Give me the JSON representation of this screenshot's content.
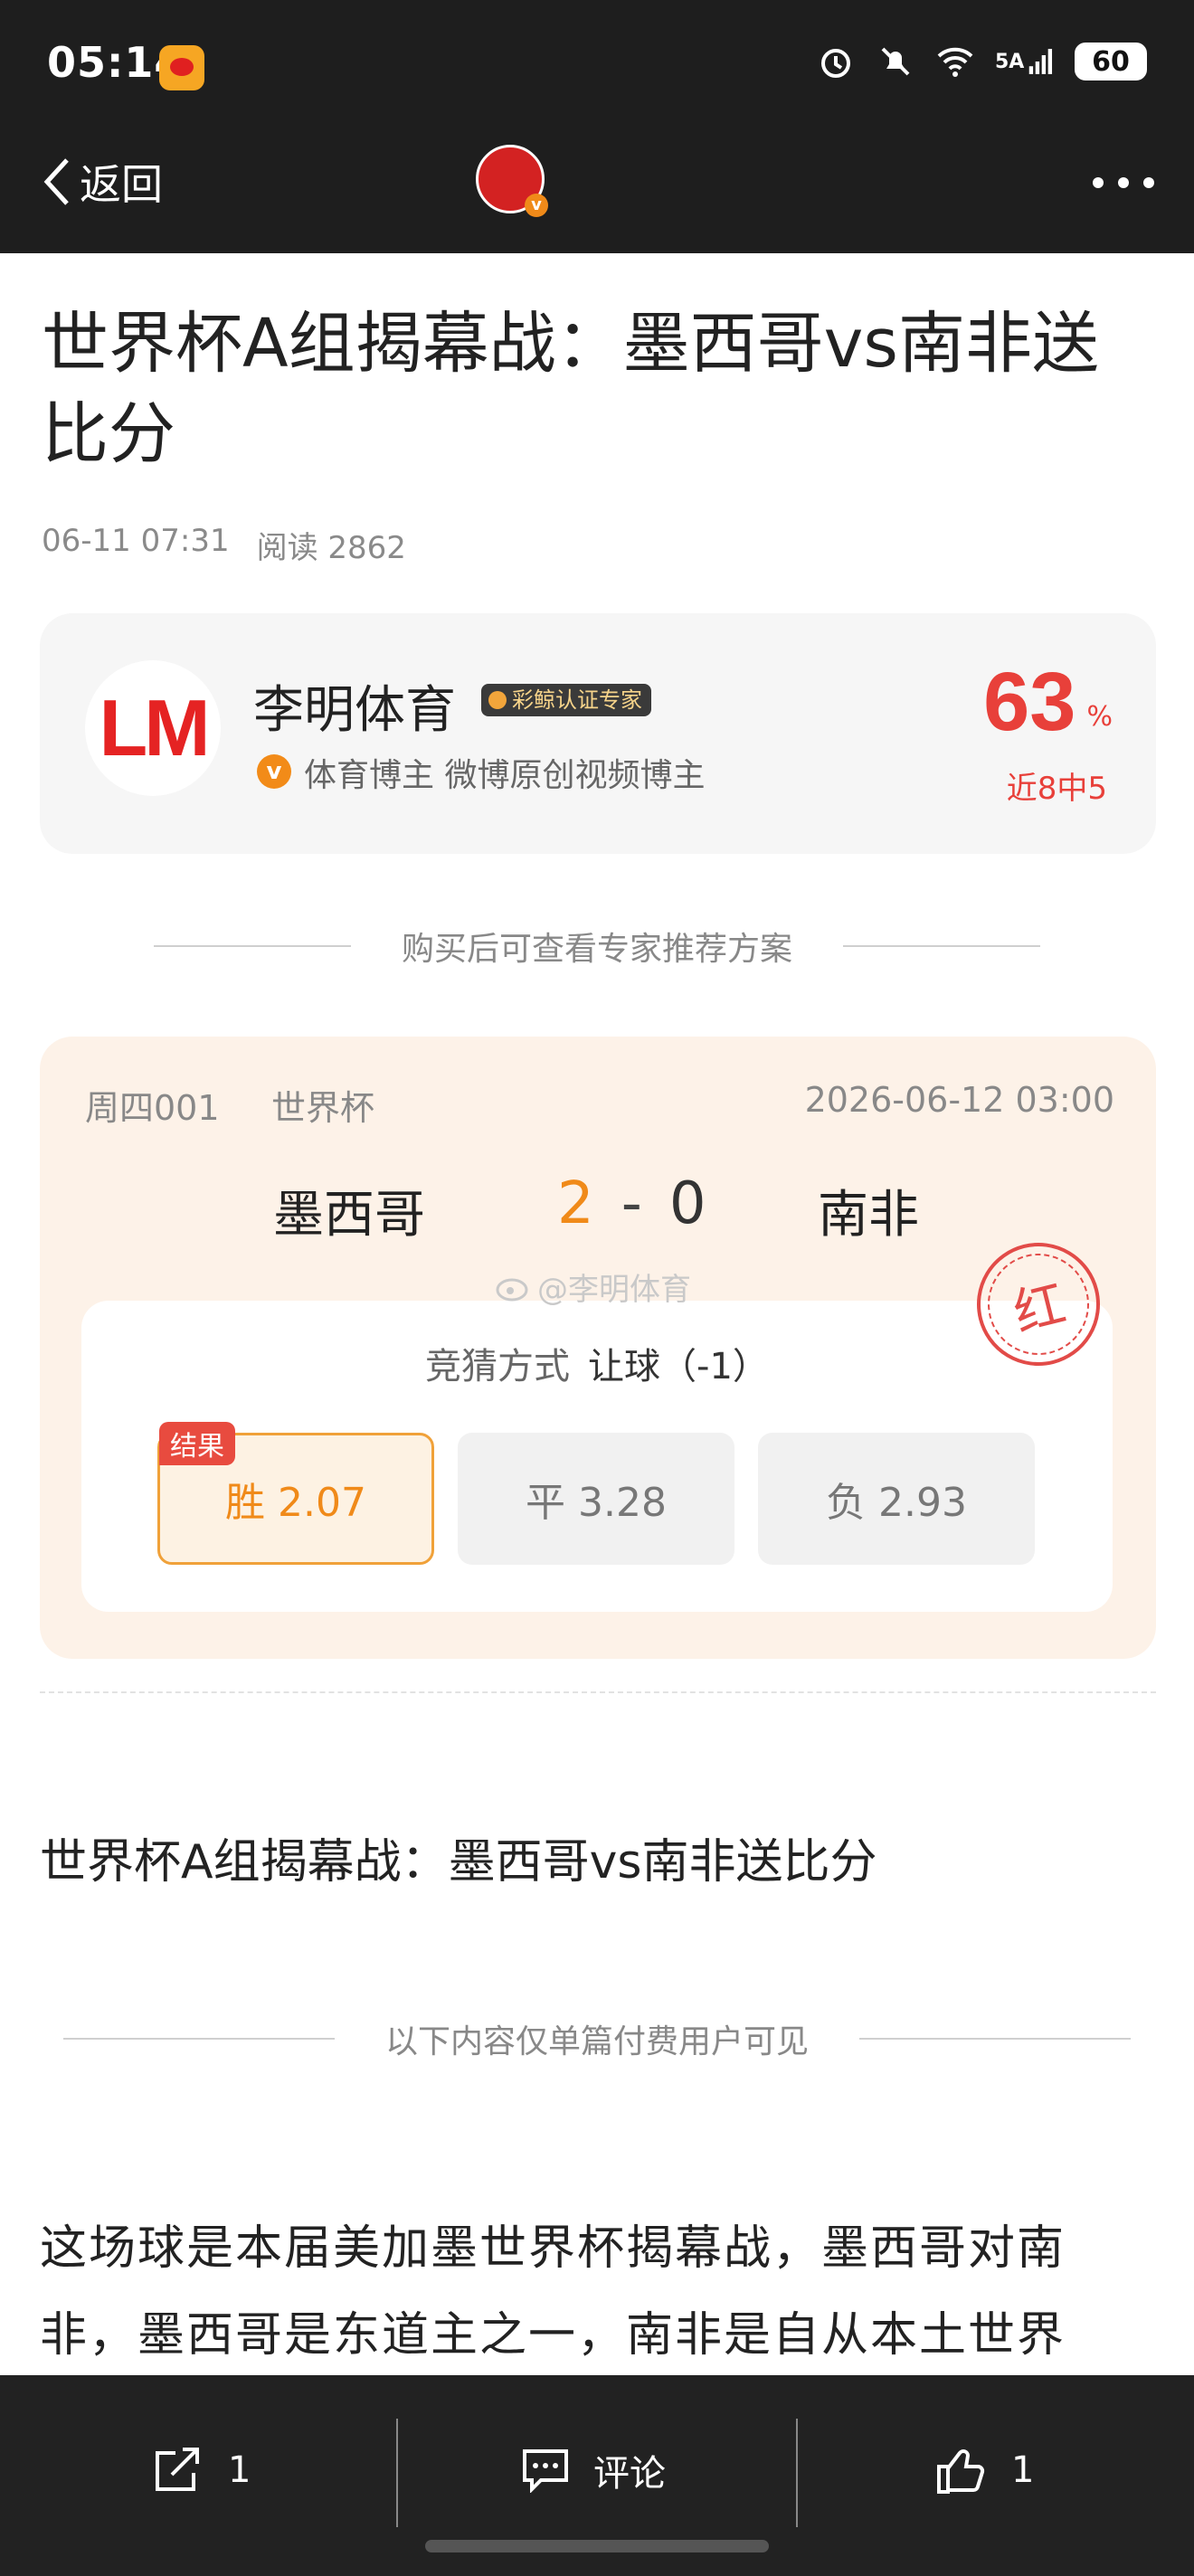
{
  "status_bar": {
    "time": "05:14",
    "network": "5A",
    "battery": "60"
  },
  "nav": {
    "back_label": "返回"
  },
  "article": {
    "title": "世界杯A组揭幕战：墨西哥vs南非送比分",
    "date": "06-11 07:31",
    "reads": "阅读 2862"
  },
  "author": {
    "logo_text": "LM",
    "name": "李明体育",
    "badge": "彩鲸认证专家",
    "desc": "体育博主 微博原创视频博主",
    "hit_rate": "63",
    "hit_unit": "%",
    "recent": "近8中5"
  },
  "divider_purchase": "购买后可查看专家推荐方案",
  "match": {
    "number": "周四001",
    "league": "世界杯",
    "datetime": "2026-06-12 03:00",
    "home": "墨西哥",
    "away": "南非",
    "home_score": "2",
    "score_sep": "-",
    "away_score": "0",
    "stamp": "红",
    "watermark": "@李明体育",
    "bet_method_label": "竞猜方式",
    "bet_method_value": "让球（-1）",
    "result_tag": "结果",
    "options": [
      {
        "label": "胜 2.07"
      },
      {
        "label": "平 3.28"
      },
      {
        "label": "负 2.93"
      }
    ]
  },
  "subtitle": "世界杯A组揭幕战：墨西哥vs南非送比分",
  "divider_paid": "以下内容仅单篇付费用户可见",
  "body_text": "这场球是本届美加墨世界杯揭幕战，墨西哥对南非，墨西哥是东道主之一，南非是自从本土世界",
  "bottom_bar": {
    "share_count": "1",
    "comment_label": "评论",
    "like_count": "1"
  }
}
